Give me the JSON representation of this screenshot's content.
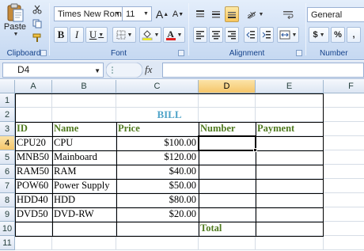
{
  "ribbon": {
    "clipboard": {
      "label": "Clipboard",
      "paste_label": "Paste"
    },
    "font": {
      "label": "Font",
      "font_name": "Times New Rom",
      "font_size": "11",
      "grow_label": "A",
      "shrink_label": "A",
      "bold_label": "B",
      "italic_label": "I",
      "underline_label": "U",
      "font_color_label": "A",
      "font_color": "#e02020",
      "fill_color": "#ffff00"
    },
    "alignment": {
      "label": "Alignment"
    },
    "number": {
      "label": "Number",
      "format": "General",
      "currency_label": "$",
      "percent_label": "%"
    }
  },
  "formula_bar": {
    "name_box": "D4",
    "fx_label": "fx",
    "formula": ""
  },
  "columns": [
    "A",
    "B",
    "C",
    "D",
    "E",
    "F"
  ],
  "rows": [
    "1",
    "2",
    "3",
    "4",
    "5",
    "6",
    "7",
    "8",
    "9",
    "10",
    "11"
  ],
  "active_cell": {
    "column": "D",
    "row": "4"
  },
  "sheet": {
    "title": "BILL",
    "headers": {
      "id": "ID",
      "name": "Name",
      "price": "Price",
      "number": "Number",
      "payment": "Payment"
    },
    "items": [
      {
        "id": "CPU20",
        "name": "CPU",
        "price": "$100.00"
      },
      {
        "id": "MNB50",
        "name": "Mainboard",
        "price": "$120.00"
      },
      {
        "id": "RAM50",
        "name": "RAM",
        "price": "$40.00"
      },
      {
        "id": "POW60",
        "name": "Power Supply",
        "price": "$50.00"
      },
      {
        "id": "HDD40",
        "name": " HDD",
        "price": "$80.00"
      },
      {
        "id": "DVD50",
        "name": "DVD-RW",
        "price": "$20.00"
      }
    ],
    "total_label": "Total"
  }
}
